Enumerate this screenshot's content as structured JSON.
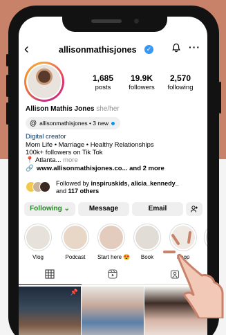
{
  "header": {
    "username": "allisonmathisjones"
  },
  "profile": {
    "full_name": "Allison Mathis Jones",
    "pronouns": "she/her",
    "stats": [
      {
        "value": "1,685",
        "label": "posts"
      },
      {
        "value": "19.9K",
        "label": "followers"
      },
      {
        "value": "2,570",
        "label": "following"
      }
    ],
    "threads_badge": "allisonmathisjones • 3 new",
    "category": "Digital creator",
    "bio": [
      "Mom Life • Marriage • Healthy Relationships",
      "100k+ followers on Tik Tok",
      "Atlanta..."
    ],
    "bio_more": "more",
    "link": "www.allisonmathisjones.co... and 2 more",
    "followed_by": {
      "prefix": "Followed by",
      "names": "inspiruskids, alicia_kennedy_",
      "mid": "and",
      "others": "117 others"
    }
  },
  "actions": {
    "following": "Following",
    "message": "Message",
    "email": "Email"
  },
  "highlights": [
    {
      "label": "Vlog"
    },
    {
      "label": "Podcast"
    },
    {
      "label": "Start here 😍"
    },
    {
      "label": "Book"
    },
    {
      "label": "Shop"
    }
  ],
  "icons": {
    "back": "chevron-left-icon",
    "verified": "verified-badge-icon",
    "bell": "bell-icon",
    "more": "more-icon",
    "threads": "threads-icon",
    "link": "link-icon",
    "add_person": "add-person-icon",
    "grid": "grid-icon",
    "reels": "reels-icon",
    "tagged": "tagged-icon"
  },
  "colors": {
    "background_top": "#c9826a",
    "phone": "#121212",
    "verified": "#3897f0",
    "following_text": "#1f8a1f",
    "link_blue": "#00376b"
  }
}
